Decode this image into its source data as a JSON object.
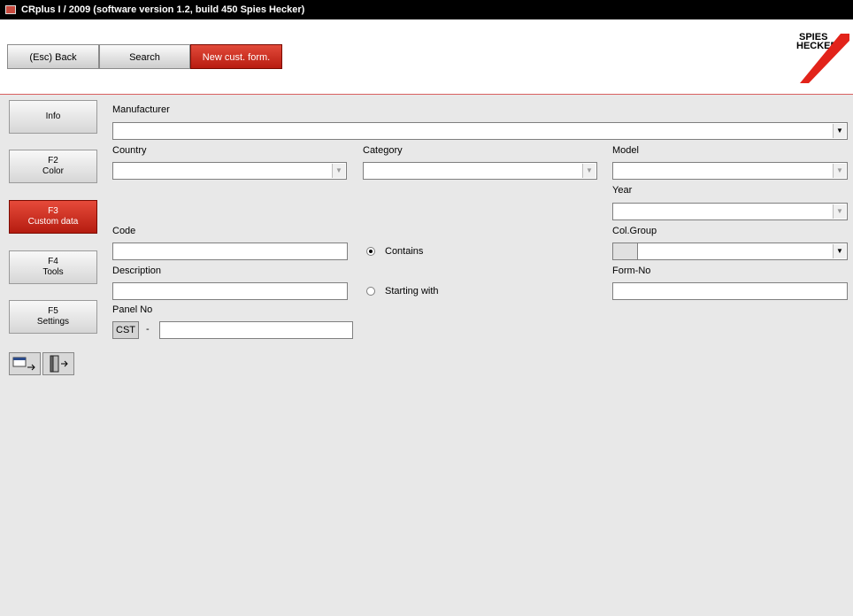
{
  "window": {
    "title": "CRplus I / 2009 (software version 1.2, build 450 Spies Hecker)"
  },
  "toolbar": {
    "back_label": "(Esc) Back",
    "search_label": "Search",
    "newform_label": "New cust. form."
  },
  "brand": {
    "line1": "SPIES",
    "line2": "HECKER",
    "accent": "#e2231a"
  },
  "sidebar": {
    "items": [
      {
        "key": "",
        "label": "Info"
      },
      {
        "key": "F2",
        "label": "Color"
      },
      {
        "key": "F3",
        "label": "Custom data"
      },
      {
        "key": "F4",
        "label": "Tools"
      },
      {
        "key": "F5",
        "label": "Settings"
      }
    ]
  },
  "form": {
    "manufacturer_label": "Manufacturer",
    "manufacturer_value": "",
    "country_label": "Country",
    "country_value": "",
    "category_label": "Category",
    "category_value": "",
    "model_label": "Model",
    "model_value": "",
    "year_label": "Year",
    "year_value": "",
    "code_label": "Code",
    "code_value": "",
    "description_label": "Description",
    "description_value": "",
    "panel_label": "Panel No",
    "panel_prefix": "CST",
    "panel_dash": "-",
    "panel_value": "",
    "colgroup_label": "Col.Group",
    "colgroup_value": "",
    "formno_label": "Form-No",
    "formno_value": "",
    "radio_contains": "Contains",
    "radio_starting": "Starting with",
    "selected_radio": "Contains"
  }
}
